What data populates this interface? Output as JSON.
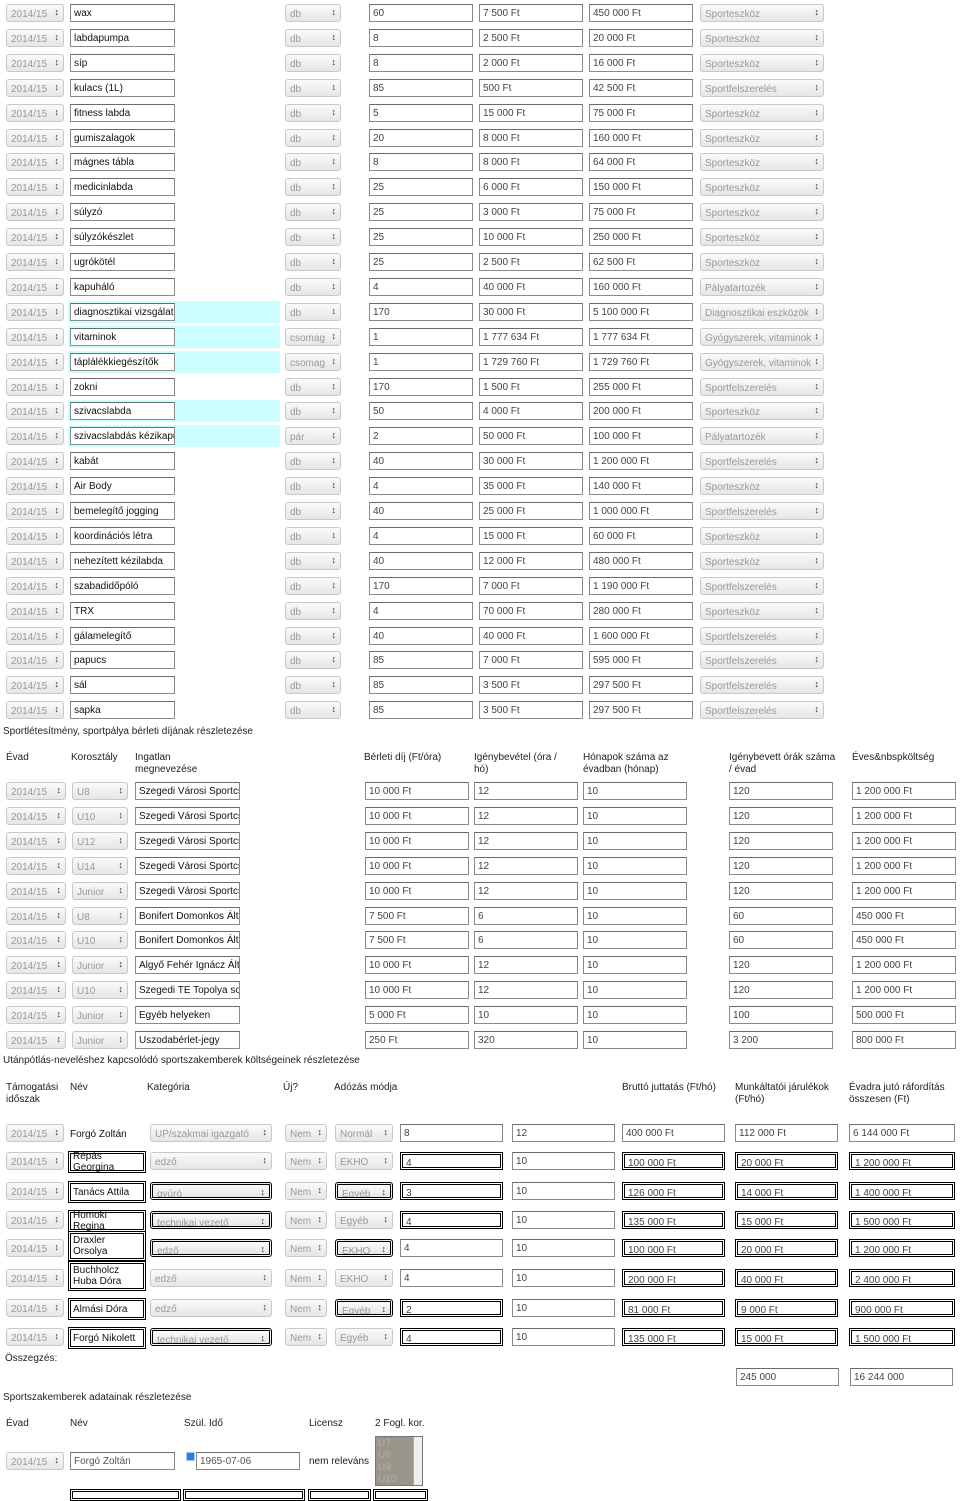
{
  "equipment": {
    "rows": [
      [
        "2014/15",
        "wax",
        "db",
        "60",
        "7 500 Ft",
        "450 000  Ft",
        "Sporteszköz"
      ],
      [
        "2014/15",
        "labdapumpa",
        "db",
        "8",
        "2 500 Ft",
        "20 000  Ft",
        "Sporteszköz"
      ],
      [
        "2014/15",
        "síp",
        "db",
        "8",
        "2 000 Ft",
        "16 000  Ft",
        "Sporteszköz"
      ],
      [
        "2014/15",
        "kulacs (1L)",
        "db",
        "85",
        "500 Ft",
        "42 500  Ft",
        "Sportfelszerelés"
      ],
      [
        "2014/15",
        "fitness labda",
        "db",
        "5",
        "15 000 Ft",
        "75 000  Ft",
        "Sporteszköz"
      ],
      [
        "2014/15",
        "gumiszalagok",
        "db",
        "20",
        "8 000 Ft",
        "160 000  Ft",
        "Sporteszköz"
      ],
      [
        "2014/15",
        "mágnes tábla",
        "db",
        "8",
        "8 000 Ft",
        "64 000  Ft",
        "Sporteszköz"
      ],
      [
        "2014/15",
        "medicinlabda",
        "db",
        "25",
        "6 000 Ft",
        "150 000  Ft",
        "Sporteszköz"
      ],
      [
        "2014/15",
        "súlyzó",
        "db",
        "25",
        "3 000 Ft",
        "75 000  Ft",
        "Sporteszköz"
      ],
      [
        "2014/15",
        "súlyzókészlet",
        "db",
        "25",
        "10 000 Ft",
        "250 000  Ft",
        "Sporteszköz"
      ],
      [
        "2014/15",
        "ugrókötél",
        "db",
        "25",
        "2 500 Ft",
        "62 500  Ft",
        "Sporteszköz"
      ],
      [
        "2014/15",
        "kapuháló",
        "db",
        "4",
        "40 000 Ft",
        "160 000  Ft",
        "Pályatartozék"
      ],
      [
        "2014/15",
        "diagnosztikai vizsgálat",
        "db",
        "170",
        "30 000 Ft",
        "5 100 000  Ft",
        "Diagnosztikai eszközök"
      ],
      [
        "2014/15",
        "vitaminok",
        "csomag",
        "1",
        "1 777 634 Ft",
        "1 777 634  Ft",
        "Gyógyszerek, vitaminok"
      ],
      [
        "2014/15",
        "táplálékkiegészítők",
        "csomag",
        "1",
        "1 729 760 Ft",
        "1 729 760  Ft",
        "Gyógyszerek, vitaminok"
      ],
      [
        "2014/15",
        "zokni",
        "db",
        "170",
        "1 500 Ft",
        "255 000  Ft",
        "Sportfelszerelés"
      ],
      [
        "2014/15",
        "szivacslabda",
        "db",
        "50",
        "4 000 Ft",
        "200 000  Ft",
        "Sporteszköz"
      ],
      [
        "2014/15",
        "szivacslabdás kézikapu",
        "pár",
        "2",
        "50 000 Ft",
        "100 000  Ft",
        "Pályatartozék"
      ],
      [
        "2014/15",
        "kabát",
        "db",
        "40",
        "30 000 Ft",
        "1 200 000  Ft",
        "Sportfelszerelés"
      ],
      [
        "2014/15",
        "Air Body",
        "db",
        "4",
        "35 000 Ft",
        "140 000  Ft",
        "Sporteszköz"
      ],
      [
        "2014/15",
        "bemelegítő jogging",
        "db",
        "40",
        "25 000 Ft",
        "1 000 000  Ft",
        "Sportfelszerelés"
      ],
      [
        "2014/15",
        "koordinációs létra",
        "db",
        "4",
        "15 000 Ft",
        "60 000  Ft",
        "Sporteszköz"
      ],
      [
        "2014/15",
        "nehezített kézilabda",
        "db",
        "40",
        "12 000 Ft",
        "480 000  Ft",
        "Sporteszköz"
      ],
      [
        "2014/15",
        "szabadidőpóló",
        "db",
        "170",
        "7 000 Ft",
        "1 190 000  Ft",
        "Sportfelszerelés"
      ],
      [
        "2014/15",
        "TRX",
        "db",
        "4",
        "70 000 Ft",
        "280 000  Ft",
        "Sporteszköz"
      ],
      [
        "2014/15",
        "gálamelegítő",
        "db",
        "40",
        "40 000 Ft",
        "1 600 000  Ft",
        "Sportfelszerelés"
      ],
      [
        "2014/15",
        "papucs",
        "db",
        "85",
        "7 000 Ft",
        "595 000  Ft",
        "Sportfelszerelés"
      ],
      [
        "2014/15",
        "sál",
        "db",
        "85",
        "3 500 Ft",
        "297 500  Ft",
        "Sportfelszerelés"
      ],
      [
        "2014/15",
        "sapka",
        "db",
        "85",
        "3 500 Ft",
        "297 500  Ft",
        "Sportfelszerelés"
      ]
    ],
    "highlighted_rows": [
      12,
      13,
      14,
      16,
      17
    ],
    "highlight_color": "#ccfeff"
  },
  "rental": {
    "title": "Sportlétesítmény, sportpálya bérleti díjának részletezése",
    "headers": [
      "Évad",
      "Korosztály",
      "Ingatlan megnevezése",
      "Bérleti díj (Ft/óra)",
      "Igénybevétel (óra / hó)",
      "Hónapok száma az évadban (hónap)",
      "Igénybevett órák száma / évad",
      "Éves&nbspköltség"
    ],
    "rows": [
      [
        "2014/15",
        "U8",
        "Szegedi Városi Sportcsarnok",
        "10 000 Ft",
        "12",
        "10",
        "120",
        "1 200 000  Ft"
      ],
      [
        "2014/15",
        "U10",
        "Szegedi Városi Sportcsarnok",
        "10 000 Ft",
        "12",
        "10",
        "120",
        "1 200 000  Ft"
      ],
      [
        "2014/15",
        "U12",
        "Szegedi Városi Sportcsarnok",
        "10 000 Ft",
        "12",
        "10",
        "120",
        "1 200 000  Ft"
      ],
      [
        "2014/15",
        "U14",
        "Szegedi Városi Sportcsarnok",
        "10 000 Ft",
        "12",
        "10",
        "120",
        "1 200 000  Ft"
      ],
      [
        "2014/15",
        "Junior",
        "Szegedi Városi Sportcsarnok",
        "10 000 Ft",
        "12",
        "10",
        "120",
        "1 200 000  Ft"
      ],
      [
        "2014/15",
        "U8",
        "Bonifert Domonkos Ált.Isk.",
        "7 500 Ft",
        "6",
        "10",
        "60",
        "450 000  Ft"
      ],
      [
        "2014/15",
        "U10",
        "Bonifert Domonkos Ált.Isk.",
        "7 500 Ft",
        "6",
        "10",
        "60",
        "450 000  Ft"
      ],
      [
        "2014/15",
        "Junior",
        "Algyő Fehér Ignácz Ált.Isk.",
        "10 000 Ft",
        "12",
        "10",
        "120",
        "1 200 000  Ft"
      ],
      [
        "2014/15",
        "U10",
        "Szegedi TE Topolya sor",
        "10 000 Ft",
        "12",
        "10",
        "120",
        "1 200 000  Ft"
      ],
      [
        "2014/15",
        "Junior",
        "Egyéb helyeken",
        "5 000 Ft",
        "10",
        "10",
        "100",
        "500 000  Ft"
      ],
      [
        "2014/15",
        "Junior",
        "Uszodabérlet-jegy",
        "250 Ft",
        "320",
        "10",
        "3 200",
        "800 000  Ft"
      ]
    ]
  },
  "staff_costs": {
    "title": "Utánpótlás-neveléshez kapcsolódó sportszakemberek költségeinek részletezése",
    "headers": [
      "Támogatási időszak",
      "Név",
      "Kategória",
      "Új?",
      "Adózás módja",
      "Bruttó juttatás (Ft/hó)",
      "Munkáltatói járulékok (Ft/hó)",
      "Évadra jutó ráfordítás összesen (Ft)"
    ],
    "rows": [
      [
        "2014/15",
        "Forgó Zoltán",
        "UP/szakmai igazgató",
        "Nem",
        "Normál",
        "8",
        "12",
        "400 000 Ft",
        "112 000  Ft",
        "6 144 000  Ft"
      ],
      [
        "2014/15",
        "Répás Georgina",
        "edző",
        "Nem",
        "EKHO",
        "4",
        "10",
        "100 000 Ft",
        "20 000  Ft",
        "1 200 000  Ft"
      ],
      [
        "2014/15",
        "Tanács Attila",
        "gyúró",
        "Nem",
        "Egyéb",
        "3",
        "10",
        "126 000 Ft",
        "14 000 Ft",
        "1 400 000  Ft"
      ],
      [
        "2014/15",
        "Homoki Regina",
        "technikai vezető",
        "Nem",
        "Egyéb",
        "4",
        "10",
        "135 000 Ft",
        "15 000 Ft",
        "1 500 000  Ft"
      ],
      [
        "2014/15",
        "Draxler Orsolya",
        "edző",
        "Nem",
        "EKHO",
        "4",
        "10",
        "100 000 Ft",
        "20 000  Ft",
        "1 200 000  Ft"
      ],
      [
        "2014/15",
        "Buchholcz Huba Dóra",
        "edző",
        "Nem",
        "EKHO",
        "4",
        "10",
        "200 000 Ft",
        "40 000  Ft",
        "2 400 000  Ft"
      ],
      [
        "2014/15",
        "Almási Dóra",
        "edző",
        "Nem",
        "Egyéb",
        "2",
        "10",
        "81 000 Ft",
        "9 000 Ft",
        "900 000  Ft"
      ],
      [
        "2014/15",
        "Forgó Nikolett",
        "technikai vezető",
        "Nem",
        "Egyéb",
        "4",
        "10",
        "135 000 Ft",
        "15 000 Ft",
        "1 500 000  Ft"
      ]
    ],
    "summary_label": "Összegzés:",
    "summary_contrib": "245 000",
    "summary_total": "16 244 000"
  },
  "staff_data": {
    "title": "Sportszakemberek adatainak részletezése",
    "headers": [
      "Évad",
      "Név",
      "Szül. Idő",
      "Licensz",
      "2 Fogl. kor."
    ],
    "row": {
      "season": "2014/15",
      "name": "Forgó Zoltán",
      "birth": "1965-07-06",
      "license": "nem releváns",
      "age_options": [
        "U7",
        "U8",
        "U9",
        "U10"
      ]
    },
    "calendar_icon": "calendar-icon"
  }
}
